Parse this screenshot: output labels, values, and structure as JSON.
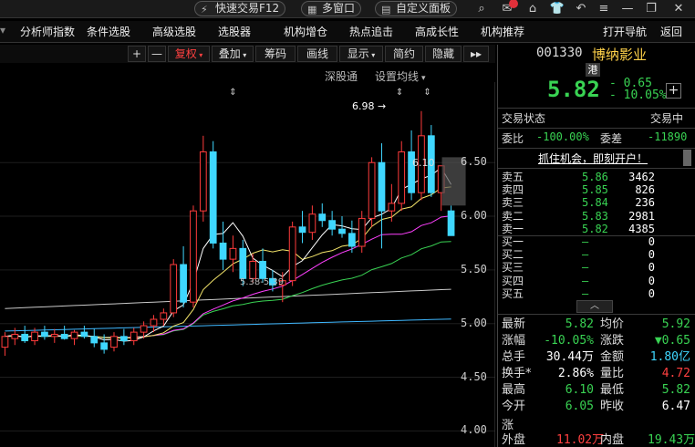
{
  "topbar": {
    "quick_trade": "快速交易F12",
    "multi_window": "多窗口",
    "custom_panel": "自定义面板"
  },
  "menu": {
    "items": [
      "分析师指数",
      "条件选股",
      "高级选股",
      "选股器",
      "机构增仓",
      "热点追击",
      "高成长性",
      "机构推荐",
      "打开导航",
      "返回"
    ]
  },
  "chart_toolbar": {
    "plus": "+",
    "minus": "—",
    "fuquan": "复权",
    "overlay": "叠加",
    "chips": "筹码",
    "drawline": "画线",
    "display": "显示",
    "simple": "简约",
    "hide": "隐藏",
    "more": "▸▸"
  },
  "chart_sub": {
    "shengutong": "深股通",
    "ma_settings": "设置均线"
  },
  "chart_annotations": {
    "high_label": "6.98",
    "range_label": "5.38-5.39",
    "last_label": "6.10"
  },
  "chart_data": {
    "type": "candlestick",
    "y_axis_ticks": [
      6.5,
      6.0,
      5.5,
      5.0,
      4.5,
      4.0
    ],
    "ylim": [
      3.85,
      7.25
    ],
    "candles": [
      {
        "o": 4.78,
        "h": 4.92,
        "l": 4.7,
        "c": 4.88
      },
      {
        "o": 4.86,
        "h": 4.96,
        "l": 4.8,
        "c": 4.9
      },
      {
        "o": 4.9,
        "h": 4.98,
        "l": 4.82,
        "c": 4.84
      },
      {
        "o": 4.84,
        "h": 4.96,
        "l": 4.8,
        "c": 4.92
      },
      {
        "o": 4.92,
        "h": 4.98,
        "l": 4.85,
        "c": 4.88
      },
      {
        "o": 4.88,
        "h": 4.95,
        "l": 4.82,
        "c": 4.9
      },
      {
        "o": 4.9,
        "h": 4.98,
        "l": 4.85,
        "c": 4.86
      },
      {
        "o": 4.86,
        "h": 4.94,
        "l": 4.8,
        "c": 4.92
      },
      {
        "o": 4.92,
        "h": 4.98,
        "l": 4.86,
        "c": 4.88
      },
      {
        "o": 4.88,
        "h": 4.95,
        "l": 4.78,
        "c": 4.82
      },
      {
        "o": 4.82,
        "h": 4.9,
        "l": 4.72,
        "c": 4.76
      },
      {
        "o": 4.78,
        "h": 4.92,
        "l": 4.74,
        "c": 4.88
      },
      {
        "o": 4.88,
        "h": 4.95,
        "l": 4.8,
        "c": 4.84
      },
      {
        "o": 4.84,
        "h": 4.96,
        "l": 4.8,
        "c": 4.92
      },
      {
        "o": 4.92,
        "h": 5.02,
        "l": 4.86,
        "c": 4.98
      },
      {
        "o": 4.98,
        "h": 5.08,
        "l": 4.92,
        "c": 5.04
      },
      {
        "o": 5.04,
        "h": 5.14,
        "l": 4.98,
        "c": 5.1
      },
      {
        "o": 5.1,
        "h": 5.6,
        "l": 5.06,
        "c": 5.55
      },
      {
        "o": 5.55,
        "h": 5.72,
        "l": 5.15,
        "c": 5.2
      },
      {
        "o": 5.2,
        "h": 6.1,
        "l": 5.15,
        "c": 6.05
      },
      {
        "o": 6.05,
        "h": 6.75,
        "l": 5.95,
        "c": 6.6
      },
      {
        "o": 6.6,
        "h": 6.7,
        "l": 5.7,
        "c": 5.75
      },
      {
        "o": 5.75,
        "h": 5.95,
        "l": 5.5,
        "c": 5.6
      },
      {
        "o": 5.6,
        "h": 5.82,
        "l": 5.48,
        "c": 5.7
      },
      {
        "o": 5.7,
        "h": 5.78,
        "l": 5.35,
        "c": 5.42
      },
      {
        "o": 5.42,
        "h": 5.65,
        "l": 5.38,
        "c": 5.58
      },
      {
        "o": 5.58,
        "h": 5.7,
        "l": 5.38,
        "c": 5.42
      },
      {
        "o": 5.42,
        "h": 5.5,
        "l": 5.3,
        "c": 5.36
      },
      {
        "o": 5.36,
        "h": 5.48,
        "l": 5.2,
        "c": 5.4
      },
      {
        "o": 5.4,
        "h": 5.95,
        "l": 5.35,
        "c": 5.9
      },
      {
        "o": 5.9,
        "h": 6.05,
        "l": 5.75,
        "c": 5.85
      },
      {
        "o": 5.85,
        "h": 6.1,
        "l": 5.78,
        "c": 6.02
      },
      {
        "o": 6.02,
        "h": 6.12,
        "l": 5.9,
        "c": 5.96
      },
      {
        "o": 5.96,
        "h": 6.05,
        "l": 5.82,
        "c": 5.88
      },
      {
        "o": 5.88,
        "h": 6.0,
        "l": 5.8,
        "c": 5.84
      },
      {
        "o": 5.84,
        "h": 5.96,
        "l": 5.66,
        "c": 5.72
      },
      {
        "o": 5.72,
        "h": 6.05,
        "l": 5.66,
        "c": 5.98
      },
      {
        "o": 5.98,
        "h": 6.55,
        "l": 5.9,
        "c": 6.5
      },
      {
        "o": 6.5,
        "h": 6.68,
        "l": 5.7,
        "c": 6.05
      },
      {
        "o": 6.05,
        "h": 6.3,
        "l": 5.95,
        "c": 6.12
      },
      {
        "o": 6.12,
        "h": 6.7,
        "l": 6.05,
        "c": 6.6
      },
      {
        "o": 6.6,
        "h": 6.8,
        "l": 6.15,
        "c": 6.22
      },
      {
        "o": 6.22,
        "h": 6.98,
        "l": 6.15,
        "c": 6.75
      },
      {
        "o": 6.75,
        "h": 6.85,
        "l": 6.18,
        "c": 6.22
      },
      {
        "o": 6.22,
        "h": 6.45,
        "l": 6.05,
        "c": 6.47
      },
      {
        "o": 6.05,
        "h": 6.1,
        "l": 5.82,
        "c": 5.82
      }
    ]
  },
  "quote": {
    "code": "001330",
    "name": "博纳影业",
    "tag": "港",
    "price": "5.82",
    "change": "- 0.65",
    "change_pct": "- 10.05%",
    "add_btn": "+",
    "status_label": "交易状态",
    "status_value": "交易中",
    "weibi_label": "委比",
    "weibi_value": "-100.00%",
    "weicha_label": "委差",
    "weicha_value": "-11890",
    "promo": "抓住机会，即刻开户！",
    "sell": [
      {
        "label": "卖五",
        "price": "5.86",
        "vol": "3462"
      },
      {
        "label": "卖四",
        "price": "5.85",
        "vol": "826"
      },
      {
        "label": "卖三",
        "price": "5.84",
        "vol": "236"
      },
      {
        "label": "卖二",
        "price": "5.83",
        "vol": "2981"
      },
      {
        "label": "卖一",
        "price": "5.82",
        "vol": "4385"
      }
    ],
    "buy": [
      {
        "label": "买一",
        "price": "—",
        "vol": "0"
      },
      {
        "label": "买二",
        "price": "—",
        "vol": "0"
      },
      {
        "label": "买三",
        "price": "—",
        "vol": "0"
      },
      {
        "label": "买四",
        "price": "—",
        "vol": "0"
      },
      {
        "label": "买五",
        "price": "—",
        "vol": "0"
      }
    ],
    "stats": [
      {
        "l1": "最新",
        "v1": "5.82",
        "c1": "green",
        "l2": "均价",
        "v2": "5.92",
        "c2": "green"
      },
      {
        "l1": "涨幅",
        "v1": "-10.05%",
        "c1": "green",
        "l2": "涨跌",
        "v2": "▼0.65",
        "c2": "green"
      },
      {
        "l1": "总手",
        "v1": "30.44万",
        "c1": "white",
        "l2": "金额",
        "v2": "1.80亿",
        "c2": "cyan"
      },
      {
        "l1": "换手*",
        "v1": "2.86%",
        "c1": "white",
        "l2": "量比",
        "v2": "4.72",
        "c2": "red2"
      },
      {
        "l1": "最高",
        "v1": "6.10",
        "c1": "green",
        "l2": "最低",
        "v2": "5.82",
        "c2": "green"
      },
      {
        "l1": "今开",
        "v1": "6.05",
        "c1": "green",
        "l2": "昨收",
        "v2": "6.47",
        "c2": "white"
      }
    ],
    "partial_a": "涨",
    "outer_label": "外盘",
    "outer_value": "11.02万",
    "inner_label": "内盘",
    "inner_value": "19.43万"
  },
  "colors": {
    "up": "#ff3b3b",
    "down": "#3fd7ff",
    "ma5": "#ffffff",
    "ma10": "#f3e46a",
    "ma20": "#ff40ff",
    "ma30": "#39d353",
    "ma60": "#c8c8c8",
    "ma120": "#3fb8ff"
  }
}
